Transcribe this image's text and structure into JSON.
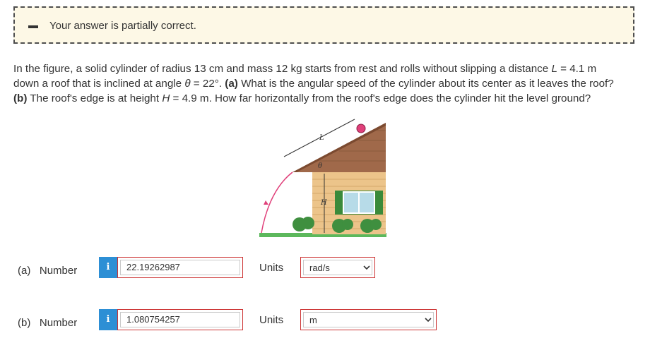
{
  "feedback": {
    "message": "Your answer is partially correct."
  },
  "question": {
    "line1": "In the figure, a solid cylinder of radius 13 cm and mass 12 kg starts from rest and rolls without slipping a distance ",
    "L_sym": "L",
    "line1b": " = 4.1 m",
    "line2a": "down a roof that is inclined at angle ",
    "theta_sym": "θ",
    "line2b": " = 22°. ",
    "a_tag": "(a)",
    "line2c": " What is the angular speed of the cylinder about its center as it leaves the roof?",
    "b_tag": "(b)",
    "line3a": " The roof's edge is at height ",
    "H_sym": "H",
    "line3b": " = 4.9 m. How far horizontally from the roof's edge does the cylinder hit the level ground?"
  },
  "figure": {
    "label_L": "L",
    "label_theta": "θ",
    "label_H": "H"
  },
  "answers": [
    {
      "part": "(a)",
      "number_label": "Number",
      "info": "i",
      "value": "22.19262987",
      "units_label": "Units",
      "unit": "rad/s"
    },
    {
      "part": "(b)",
      "number_label": "Number",
      "info": "i",
      "value": "1.080754257",
      "units_label": "Units",
      "unit": "m"
    }
  ],
  "colors": {
    "banner_bg": "#fdf8e6",
    "info_blue": "#2d8fd5",
    "error_red": "#cc3333",
    "roof_brown": "#a0694a",
    "wall_tan": "#ecc48a",
    "grass_green": "#5cb85c"
  }
}
